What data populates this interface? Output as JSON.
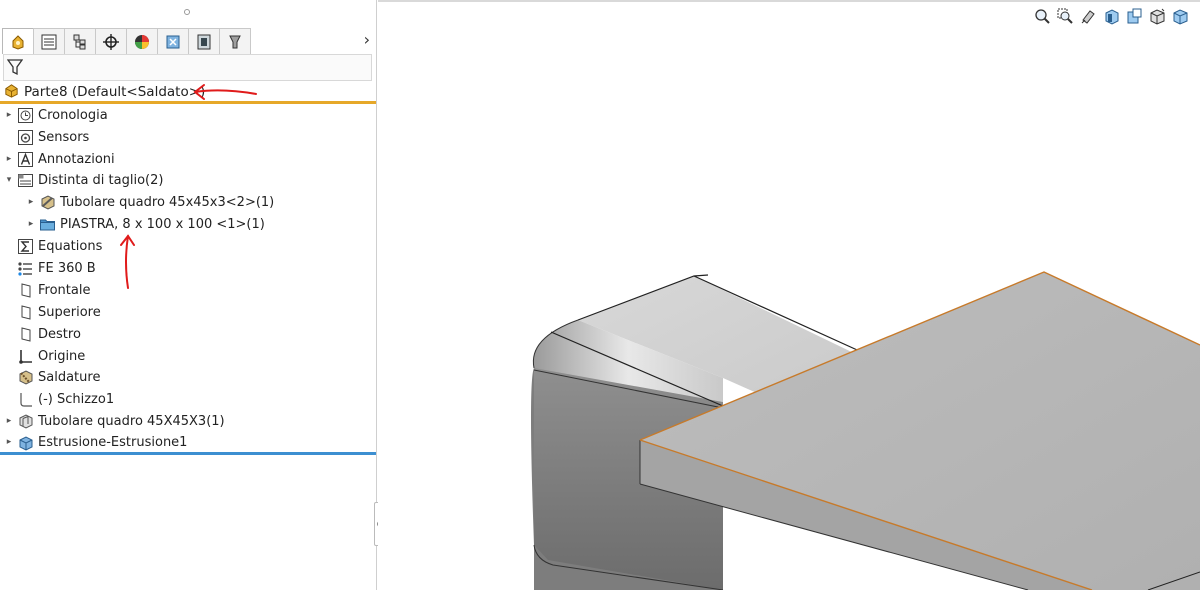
{
  "tree": {
    "root_label": "Parte8 (Default<Saldato>)",
    "items": [
      {
        "label": "Cronologia",
        "expander": "▸",
        "icon": "history-icon"
      },
      {
        "label": "Sensors",
        "expander": "",
        "icon": "sensor-icon"
      },
      {
        "label": "Annotazioni",
        "expander": "▸",
        "icon": "annotation-icon"
      },
      {
        "label": "Distinta di taglio(2)",
        "expander": "▾",
        "icon": "cut-list-icon"
      },
      {
        "label": "Tubolare quadro 45x45x3<2>(1)",
        "expander": "▸",
        "icon": "weldment-body-icon"
      },
      {
        "label": "PIASTRA, 8 x 100 x 100 <1>(1)",
        "expander": "▸",
        "icon": "folder-icon"
      },
      {
        "label": "Equations",
        "expander": "",
        "icon": "equations-icon"
      },
      {
        "label": "FE 360 B",
        "expander": "",
        "icon": "material-icon"
      },
      {
        "label": "Frontale",
        "expander": "",
        "icon": "plane-icon"
      },
      {
        "label": "Superiore",
        "expander": "",
        "icon": "plane-icon"
      },
      {
        "label": "Destro",
        "expander": "",
        "icon": "plane-icon"
      },
      {
        "label": "Origine",
        "expander": "",
        "icon": "origin-icon"
      },
      {
        "label": "Saldature",
        "expander": "",
        "icon": "weld-bead-icon"
      },
      {
        "label": "(-) Schizzo1",
        "expander": "",
        "icon": "sketch-icon"
      },
      {
        "label": "Tubolare quadro 45X45X3(1)",
        "expander": "▸",
        "icon": "structural-member-icon"
      },
      {
        "label": "Estrusione-Estrusione1",
        "expander": "▸",
        "icon": "extrude-icon"
      }
    ]
  },
  "tabs": [
    {
      "icon": "feature-manager-icon",
      "active": true
    },
    {
      "icon": "property-manager-icon",
      "active": false
    },
    {
      "icon": "configuration-manager-icon",
      "active": false
    },
    {
      "icon": "dimxpert-icon",
      "active": false
    },
    {
      "icon": "display-manager-icon",
      "active": false
    },
    {
      "icon": "cam-icon",
      "active": false
    },
    {
      "icon": "simulation-icon",
      "active": false
    },
    {
      "icon": "weldment-tab-icon",
      "active": false
    }
  ],
  "tab_more": "›",
  "heads_up_icons": [
    "zoom-to-fit-icon",
    "zoom-to-area-icon",
    "previous-view-icon",
    "section-view-icon",
    "dynamic-annotation-icon",
    "view-orientation-icon",
    "display-style-icon"
  ],
  "colors": {
    "accent_orange": "#e6a829",
    "accent_blue": "#3c8fd1",
    "annotation_red": "#e01b1b",
    "edge_orange": "#c77a2a"
  }
}
